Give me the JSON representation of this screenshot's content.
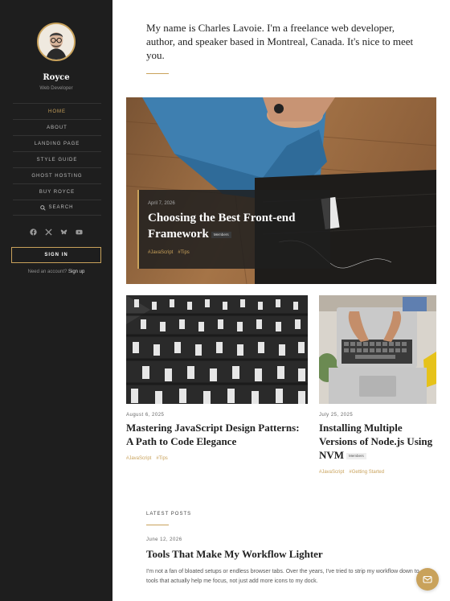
{
  "sidebar": {
    "site_name": "Royce",
    "site_role": "Web Developer",
    "nav": [
      {
        "label": "HOME"
      },
      {
        "label": "ABOUT"
      },
      {
        "label": "LANDING PAGE"
      },
      {
        "label": "STYLE GUIDE"
      },
      {
        "label": "GHOST HOSTING"
      },
      {
        "label": "BUY ROYCE"
      },
      {
        "label": "SEARCH",
        "icon": "search-icon"
      }
    ],
    "active_item": "HOME",
    "socials": [
      "facebook-icon",
      "x-icon",
      "bluesky-icon",
      "youtube-icon"
    ],
    "signin_label": "SIGN IN",
    "account_prompt": "Need an account?",
    "signup_label": "Sign up"
  },
  "intro": "My name is Charles Lavoie. I'm a freelance web developer, author, and speaker based in Montreal, Canada. It's nice to meet you.",
  "featured": {
    "date": "April 7, 2026",
    "title": "Choosing the Best Front-end Framework",
    "badge": "Members",
    "tags": [
      "#JavaScript",
      "#Tips"
    ]
  },
  "cards": [
    {
      "date": "August 6, 2025",
      "title": "Mastering JavaScript Design Patterns: A Path to Code Elegance",
      "tags": [
        "#JavaScript",
        "#Tips"
      ]
    },
    {
      "date": "July 25, 2025",
      "title": "Installing Multiple Versions of Node.js Using NVM",
      "badge": "Members",
      "tags": [
        "#JavaScript",
        "#Getting Started"
      ]
    }
  ],
  "latest": {
    "heading": "LATEST POSTS",
    "post": {
      "date": "June 12, 2026",
      "title": "Tools That Make My Workflow Lighter",
      "excerpt": "I'm not a fan of bloated setups or endless browser tabs. Over the years, I've tried to strip my workflow down to tools that actually help me focus, not just add more icons to my dock."
    }
  },
  "colors": {
    "accent": "#c9a25b",
    "sidebar": "#1e1e1e"
  }
}
